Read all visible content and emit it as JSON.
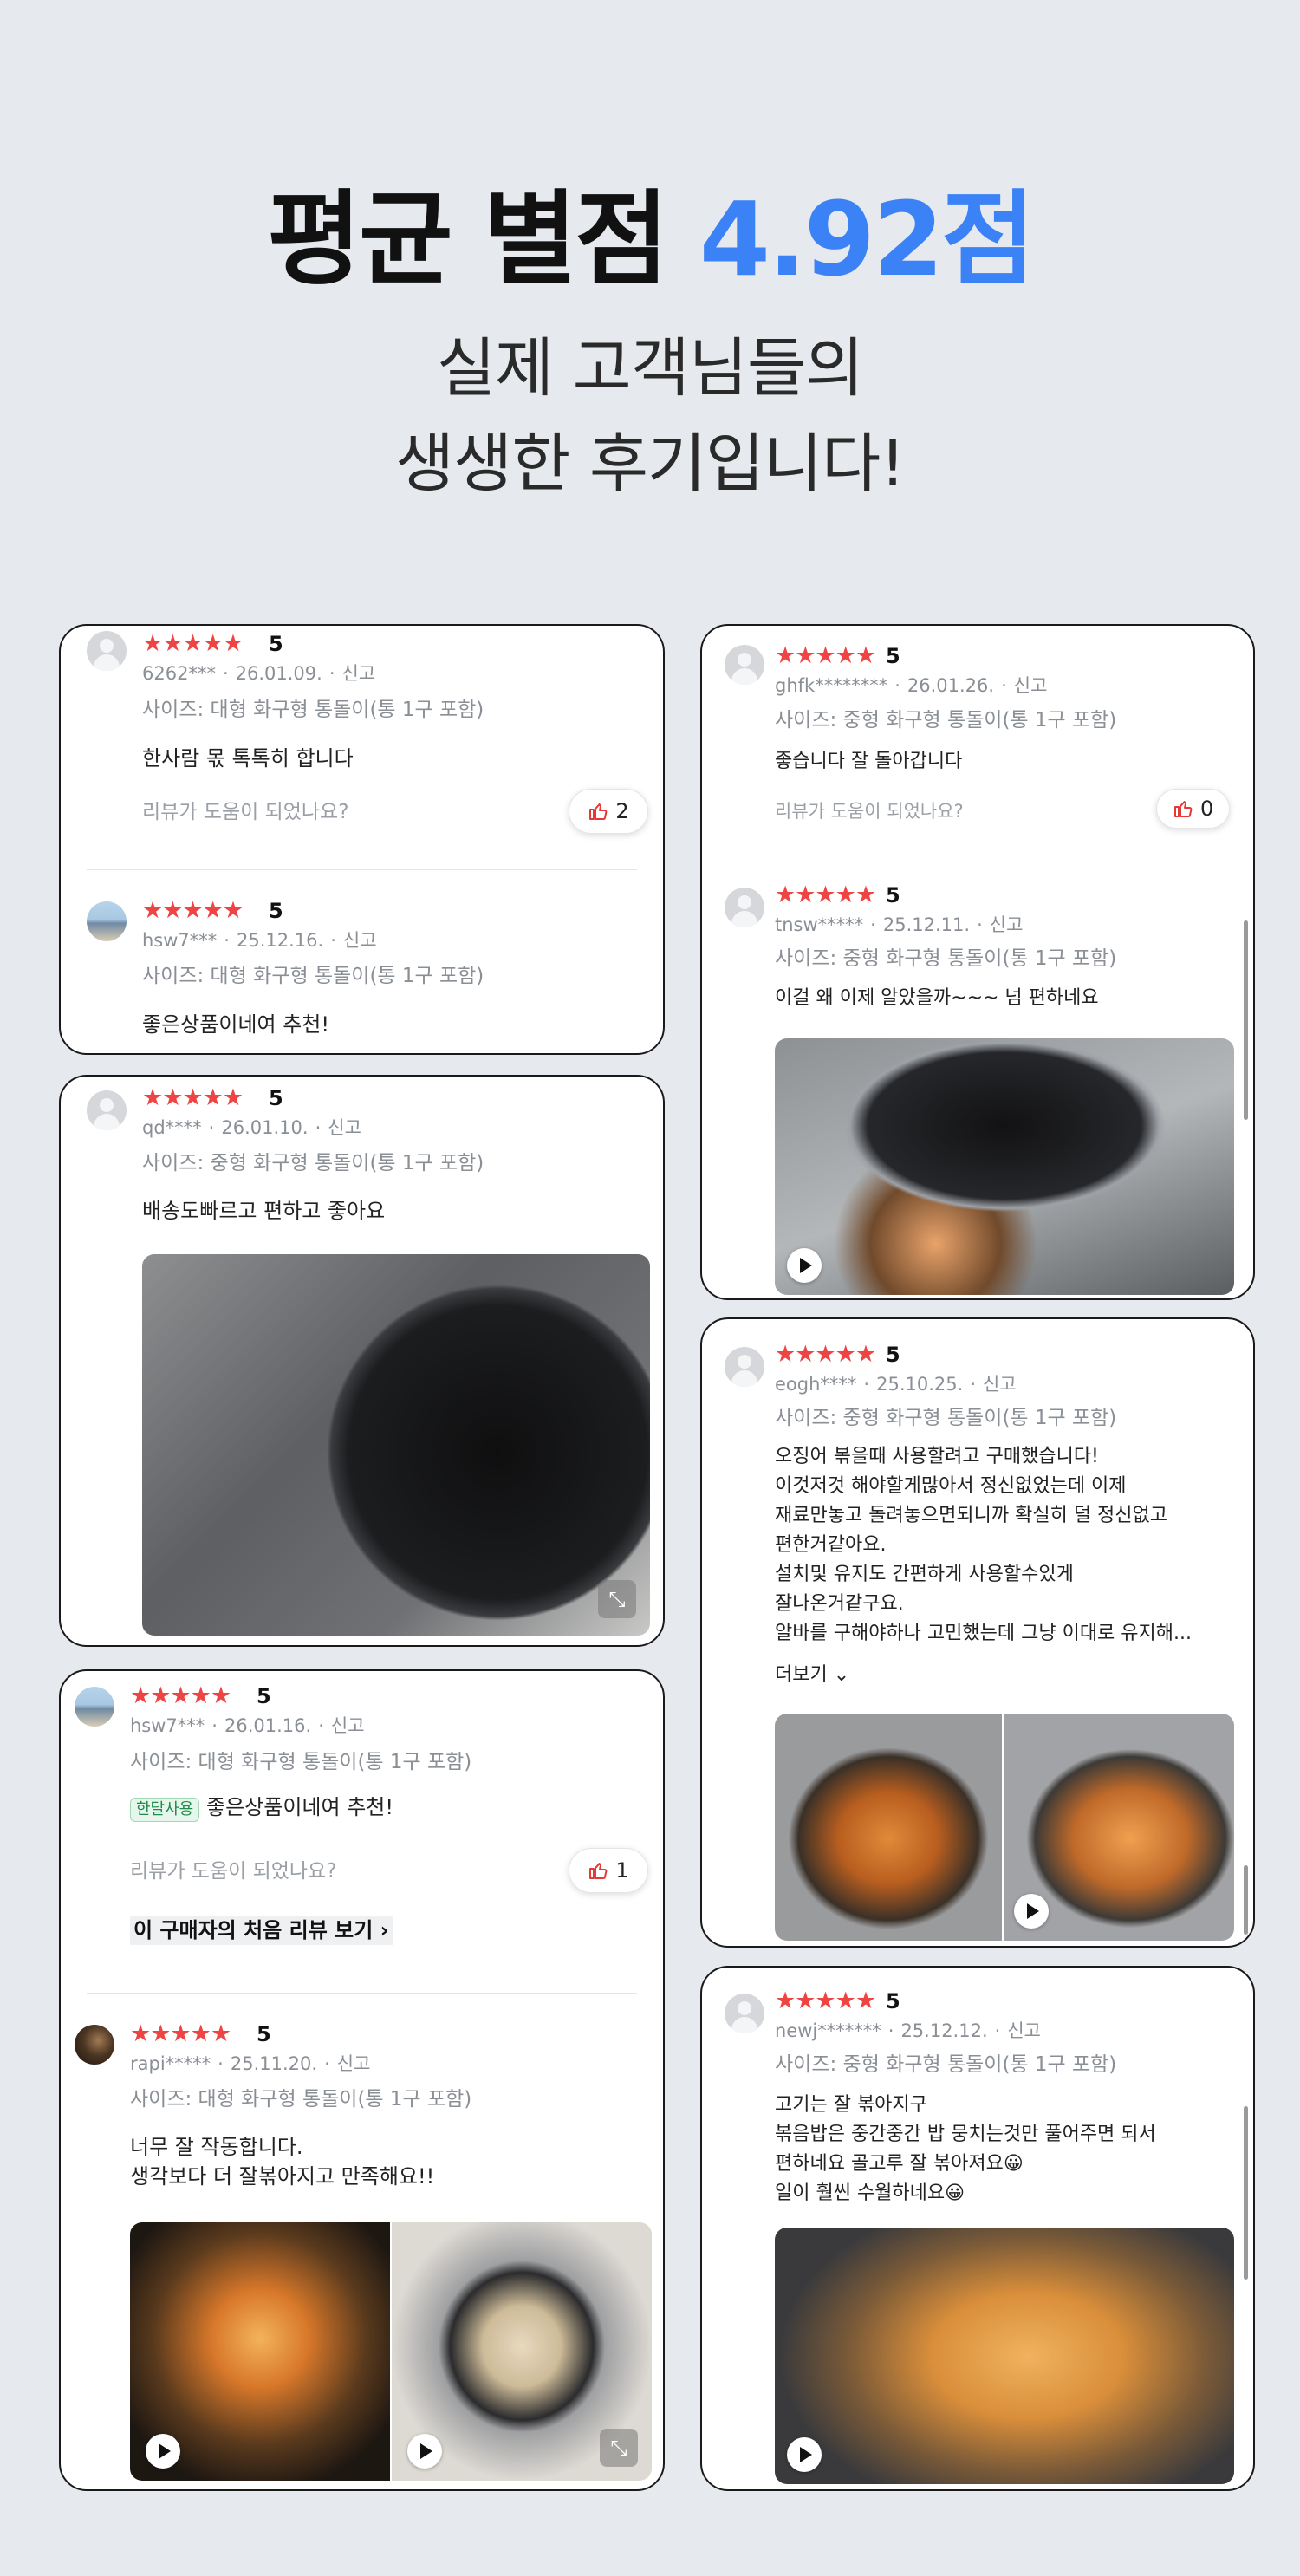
{
  "header": {
    "title_prefix": "평균 별점 ",
    "title_accent": "4.92점",
    "subtitle_line1": "실제 고객님들의",
    "subtitle_line2": "생생한 후기입니다!",
    "accent_color": "#3b82f6"
  },
  "star_color": "#ef4444",
  "common": {
    "stars": "★★★★★",
    "report": "신고",
    "helpful_question": "리뷰가 도움이 되었나요?",
    "dot": "·"
  },
  "reviews": {
    "r1": {
      "rating": "5",
      "user": "6262***",
      "date": "26.01.09.",
      "option": "사이즈: 대형 화구형 통돌이(통 1구 포함)",
      "text": "한사람 몫 톡톡히 합니다",
      "likes": "2"
    },
    "r2": {
      "rating": "5",
      "user": "hsw7***",
      "date": "25.12.16.",
      "option": "사이즈: 대형 화구형 통돌이(통 1구 포함)",
      "text": "좋은상품이네여 추천!"
    },
    "r3": {
      "rating": "5",
      "user": "qd****",
      "date": "26.01.10.",
      "option": "사이즈: 중형 화구형 통돌이(통 1구 포함)",
      "text": "배송도빠르고  편하고 좋아요"
    },
    "r4": {
      "rating": "5",
      "user": "hsw7***",
      "date": "26.01.16.",
      "option": "사이즈: 대형 화구형 통돌이(통 1구 포함)",
      "badge": "한달사용",
      "text": "좋은상품이네여 추천!",
      "likes": "1",
      "first_review_link": "이 구매자의 처음 리뷰 보기"
    },
    "r5": {
      "rating": "5",
      "user": "rapi*****",
      "date": "25.11.20.",
      "option": "사이즈: 대형 화구형 통돌이(통 1구 포함)",
      "text": "너무 잘 작동합니다.\n생각보다 더 잘볶아지고 만족해요!!"
    },
    "r6": {
      "rating": "5",
      "user": "ghfk********",
      "date": "26.01.26.",
      "option": "사이즈: 중형 화구형 통돌이(통 1구 포함)",
      "text": "좋습니다 잘 돌아갑니다",
      "likes": "0"
    },
    "r7": {
      "rating": "5",
      "user": "tnsw*****",
      "date": "25.12.11.",
      "option": "사이즈: 중형 화구형 통돌이(통 1구 포함)",
      "text": "이걸 왜 이제 알았을까~~~ 넘 편하네요"
    },
    "r8": {
      "rating": "5",
      "user": "eogh****",
      "date": "25.10.25.",
      "option": "사이즈: 중형 화구형 통돌이(통 1구 포함)",
      "text": "오징어 볶을때 사용할려고 구매했습니다!\n이것저것 해야할게많아서 정신없었는데 이제\n재료만놓고 돌려놓으면되니까 확실히 덜 정신없고\n편한거같아요.\n 설치및 유지도 간편하게 사용할수있게\n잘나온거같구요.\n 알바를 구해야하나 고민했는데 그냥 이대로 유지해...",
      "more": "더보기"
    },
    "r9": {
      "rating": "5",
      "user": "newj*******",
      "date": "25.12.12.",
      "option": "사이즈: 중형 화구형 통돌이(통 1구 포함)",
      "text": "고기는 잘 볶아지구\n볶음밥은 중간중간 밥 뭉치는것만 풀어주면 되서\n편하네요 골고루 잘 볶아져요😀\n일이 훨씬 수월하네요😀"
    }
  }
}
